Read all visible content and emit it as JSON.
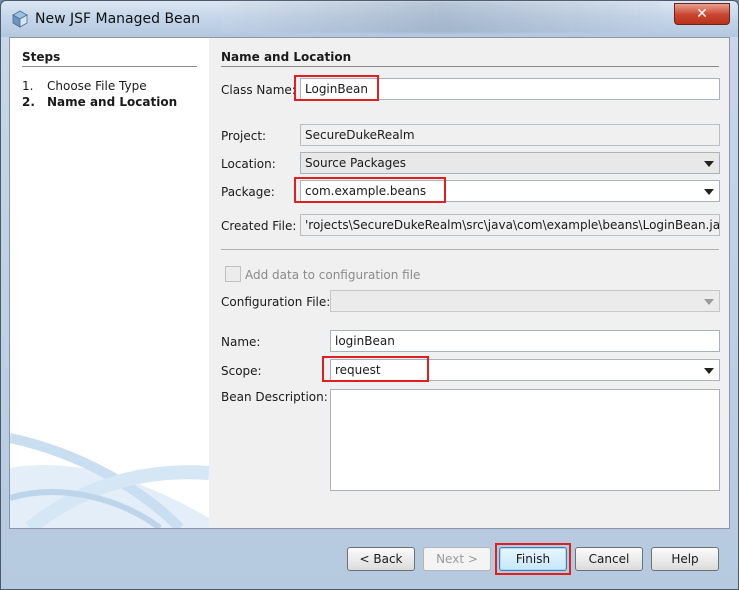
{
  "window": {
    "title": "New JSF Managed Bean",
    "close_glyph": "✕"
  },
  "steps": {
    "heading": "Steps",
    "items": [
      {
        "num": "1.",
        "label": "Choose File Type",
        "current": false
      },
      {
        "num": "2.",
        "label": "Name and Location",
        "current": true
      }
    ]
  },
  "form": {
    "section_title": "Name and Location",
    "class_name": {
      "label": "Class Name:",
      "value": "LoginBean"
    },
    "project": {
      "label": "Project:",
      "value": "SecureDukeRealm"
    },
    "location": {
      "label": "Location:",
      "value": "Source Packages"
    },
    "package": {
      "label": "Package:",
      "value": "com.example.beans"
    },
    "created_file": {
      "label": "Created File:",
      "value": "'rojects\\SecureDukeRealm\\src\\java\\com\\example\\beans\\LoginBean.java"
    },
    "add_config": {
      "label": "Add data to configuration file",
      "checked": false,
      "enabled": false
    },
    "config_file": {
      "label": "Configuration File:",
      "value": ""
    },
    "name": {
      "label": "Name:",
      "value": "loginBean"
    },
    "scope": {
      "label": "Scope:",
      "value": "request"
    },
    "bean_description": {
      "label": "Bean Description:",
      "value": ""
    }
  },
  "buttons": {
    "back": "< Back",
    "next": "Next >",
    "finish": "Finish",
    "cancel": "Cancel",
    "help": "Help"
  },
  "colors": {
    "highlight": "#e02020",
    "title_bar": "#c5d6ea",
    "close_button": "#c9452f"
  }
}
